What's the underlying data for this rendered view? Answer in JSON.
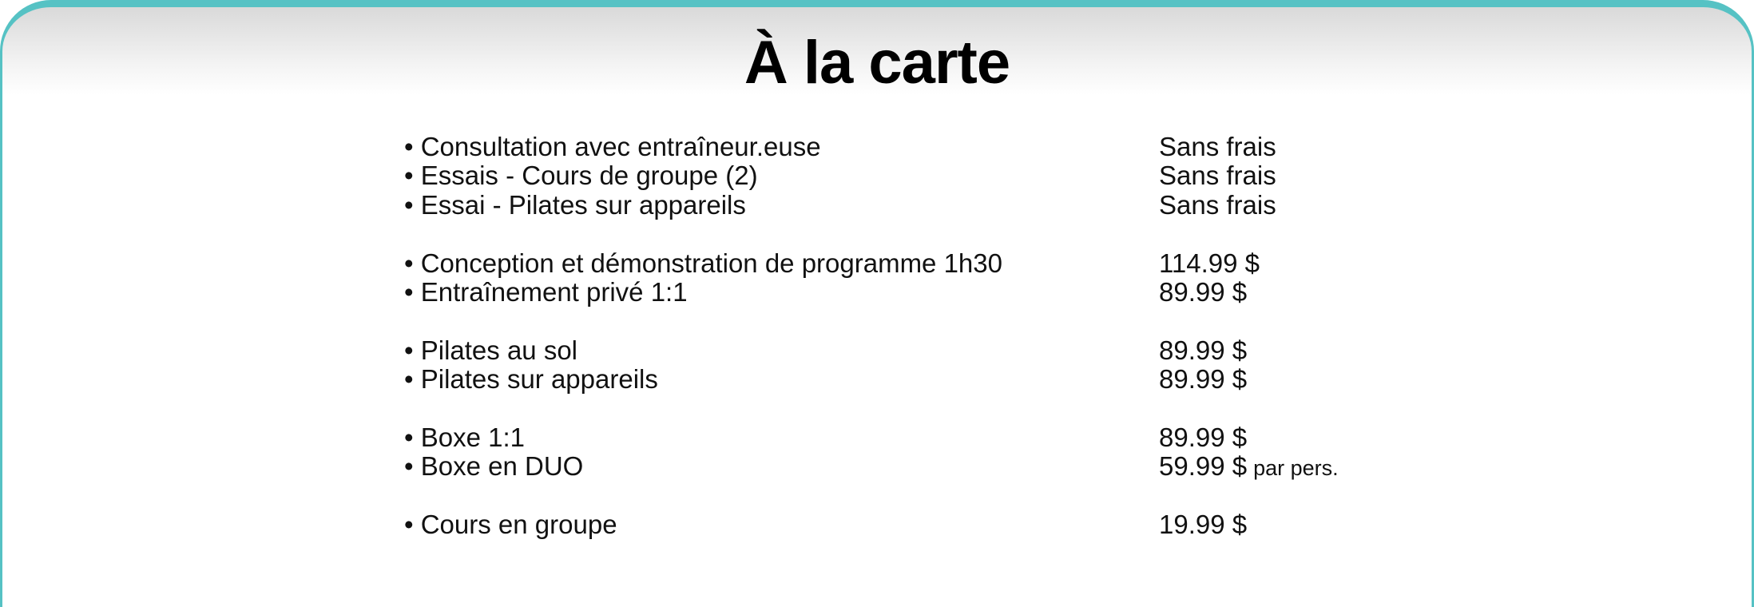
{
  "title": "À la carte",
  "accent_color": "#56c2c4",
  "groups": [
    {
      "items": [
        {
          "label": "• Consultation avec entraîneur.euse",
          "price": "Sans frais"
        },
        {
          "label": "• Essais - Cours de groupe (2)",
          "price": "Sans frais"
        },
        {
          "label": "• Essai - Pilates sur appareils",
          "price": "Sans frais"
        }
      ]
    },
    {
      "items": [
        {
          "label": "• Conception et démonstration de programme 1h30",
          "price": "114.99 $"
        },
        {
          "label": "• Entraînement privé 1:1",
          "price": "89.99 $"
        }
      ]
    },
    {
      "items": [
        {
          "label": "• Pilates au sol",
          "price": "89.99 $"
        },
        {
          "label": "• Pilates sur appareils",
          "price": "89.99 $"
        }
      ]
    },
    {
      "items": [
        {
          "label": "• Boxe 1:1",
          "price": "89.99 $"
        },
        {
          "label": "• Boxe en DUO",
          "price": "59.99 $",
          "note": "par pers."
        }
      ]
    },
    {
      "items": [
        {
          "label": "• Cours en groupe",
          "price": "19.99 $"
        }
      ]
    }
  ]
}
